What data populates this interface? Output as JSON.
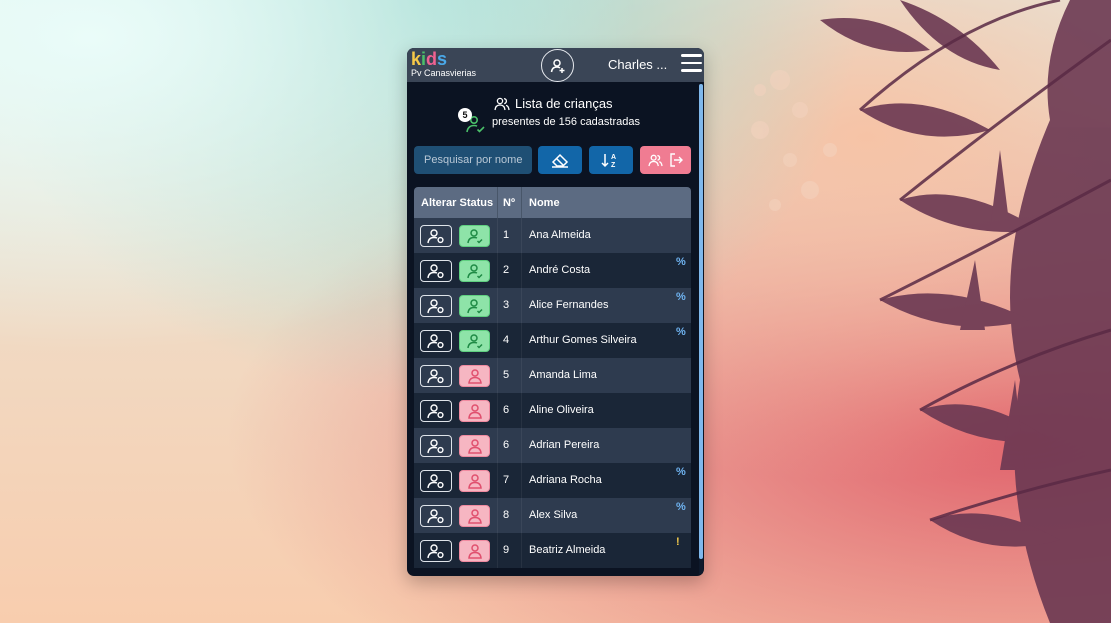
{
  "app": {
    "logo_letters": [
      {
        "ch": "k",
        "color": "#f7c948"
      },
      {
        "ch": "i",
        "color": "#4bc06a"
      },
      {
        "ch": "d",
        "color": "#f06292"
      },
      {
        "ch": "s",
        "color": "#4aa8e8"
      }
    ],
    "location": "Pv Canasvierias",
    "user_name": "Charles ..."
  },
  "list": {
    "title": "Lista de crianças",
    "subtitle": "presentes de 156 cadastradas",
    "present_count": "5"
  },
  "controls": {
    "search_placeholder": "Pesquisar por nome"
  },
  "table": {
    "headers": {
      "status": "Alterar Status",
      "num": "Nº",
      "name": "Nome"
    },
    "rows": [
      {
        "num": "1",
        "name": "Ana Almeida",
        "present": true,
        "flag": ""
      },
      {
        "num": "2",
        "name": "André Costa",
        "present": true,
        "flag": "%"
      },
      {
        "num": "3",
        "name": "Alice Fernandes",
        "present": true,
        "flag": "%"
      },
      {
        "num": "4",
        "name": "Arthur Gomes Silveira",
        "present": true,
        "flag": "%"
      },
      {
        "num": "5",
        "name": "Amanda Lima",
        "present": false,
        "flag": ""
      },
      {
        "num": "6",
        "name": "Aline Oliveira",
        "present": false,
        "flag": ""
      },
      {
        "num": "6",
        "name": "Adrian Pereira",
        "present": false,
        "flag": ""
      },
      {
        "num": "7",
        "name": "Adriana Rocha",
        "present": false,
        "flag": "%"
      },
      {
        "num": "8",
        "name": "Alex Silva",
        "present": false,
        "flag": "%"
      },
      {
        "num": "9",
        "name": "Beatriz Almeida",
        "present": false,
        "flag": "!"
      }
    ]
  },
  "colors": {
    "present": "#8ee3a8",
    "absent": "#f6b6c2",
    "accent_blue": "#1266a8",
    "exit_pink": "#f07c92"
  }
}
